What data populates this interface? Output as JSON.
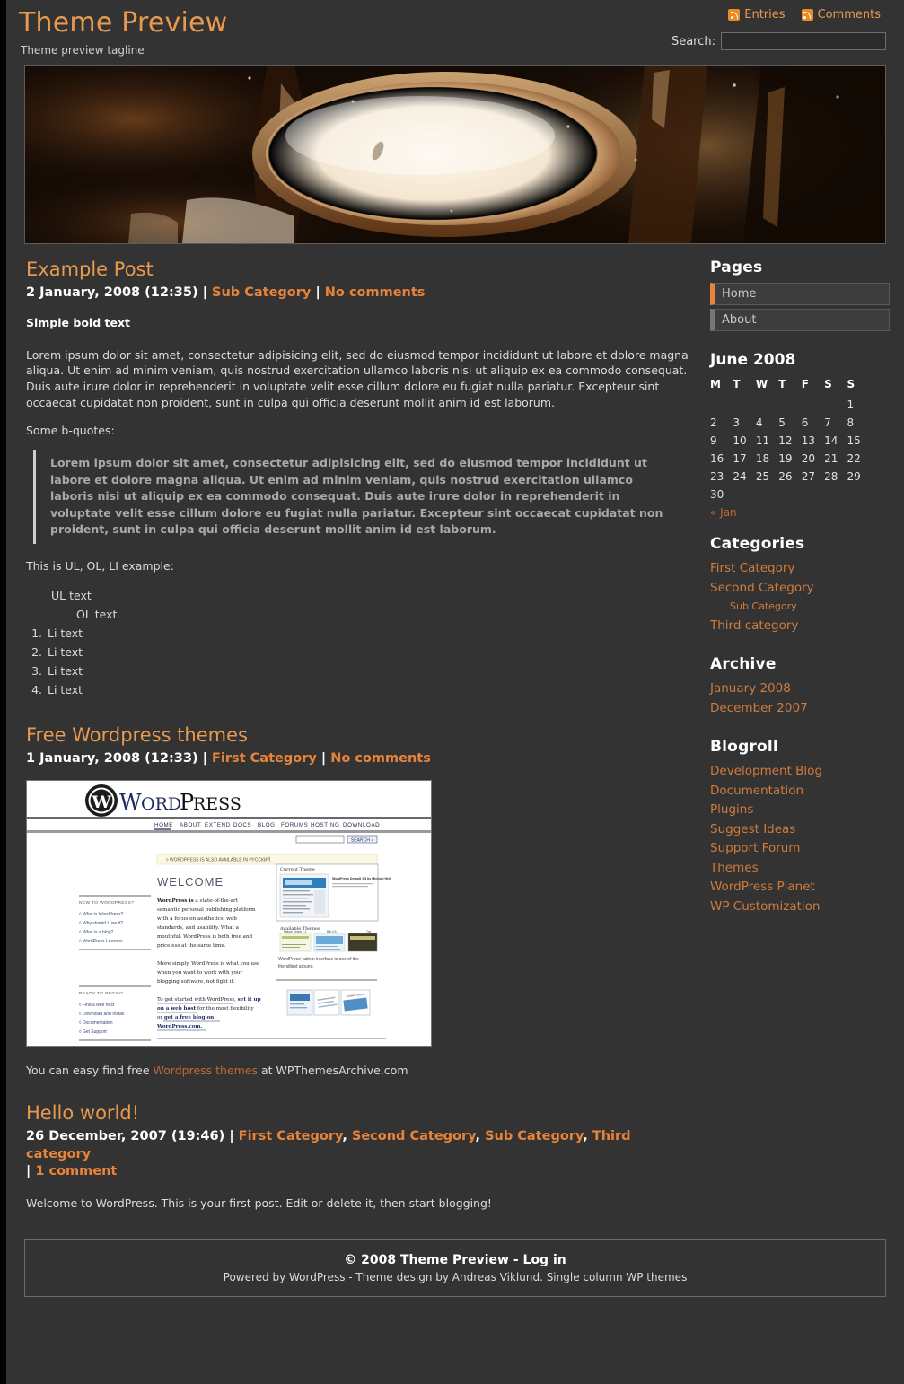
{
  "header": {
    "blog_title": "Theme Preview",
    "tagline": "Theme preview tagline",
    "feed_entries": "Entries",
    "feed_comments": "Comments",
    "search_label": "Search:",
    "search_value": "",
    "search_placeholder": ""
  },
  "colors": {
    "accent": "#e8994f",
    "link": "#cf7b3c",
    "page_bg": "#333333",
    "outer_bg": "#000000",
    "rss_orange": "#e98b28"
  },
  "posts": [
    {
      "title": "Example Post",
      "date": "2 January, 2008 (12:35)",
      "category": "Sub Category",
      "comments": "No comments",
      "bold_line": "Simple bold text",
      "paragraph": "Lorem ipsum dolor sit amet, consectetur adipisicing elit, sed do eiusmod tempor incididunt ut labore et dolore magna aliqua. Ut enim ad minim veniam, quis nostrud exercitation ullamco laboris nisi ut aliquip ex ea commodo consequat. Duis aute irure dolor in reprehenderit in voluptate velit esse cillum dolore eu fugiat nulla pariatur. Excepteur sint occaecat cupidatat non proident, sunt in culpa qui officia deserunt mollit anim id est laborum.",
      "quote_intro": "Some b-quotes:",
      "quote": "Lorem ipsum dolor sit amet, consectetur adipisicing elit, sed do eiusmod tempor incididunt ut labore et dolore magna aliqua. Ut enim ad minim veniam, quis nostrud exercitation ullamco laboris nisi ut aliquip ex ea commodo consequat. Duis aute irure dolor in reprehenderit in voluptate velit esse cillum dolore eu fugiat nulla pariatur. Excepteur sint occaecat cupidatat non proident, sunt in culpa qui officia deserunt mollit anim id est laborum.",
      "list_intro": "This is UL, OL, LI example:",
      "ul_text": "UL text",
      "ol_text": "OL text",
      "li_items": [
        "Li text",
        "Li text",
        "Li text",
        "Li text"
      ]
    },
    {
      "title": "Free Wordpress themes",
      "date": "1 January, 2008 (12:33)",
      "category": "First Category",
      "comments": "No comments",
      "after_image_prefix": "You can easy find free ",
      "after_image_link": "Wordpress themes",
      "after_image_suffix": " at WPThemesArchive.com"
    },
    {
      "title": "Hello world!",
      "date": "26 December, 2007 (19:46)",
      "categories": [
        "First Category",
        "Second Category",
        "Sub Category",
        "Third category"
      ],
      "comments": "1 comment",
      "body": "Welcome to WordPress. This is your first post. Edit or delete it, then start blogging!"
    }
  ],
  "screenshot": {
    "brand": "WORDPRESS",
    "nav": [
      "HOME",
      "ABOUT",
      "EXTEND",
      "DOCS",
      "BLOG",
      "FORUMS",
      "HOSTING",
      "DOWNLOAD"
    ],
    "search_button": "SEARCH »",
    "notice": "◊ WORDPRESS IS ALSO AVAILABLE IN РУССКИЙ.",
    "welcome": "WELCOME",
    "intro_bold": "WordPress is",
    "intro_rest": "a state-of-the-art semantic personal publishing platform with a focus on aesthetics, web standards, and usability. What a mouthful. WordPress is both free and priceless at the same time.",
    "para2": "More simply, WordPress is what you use when you want to work with your blogging software, not fight it.",
    "para3_prefix": "To get started with WordPress, ",
    "para3_link1": "set it up on a web host",
    "para3_mid": " for the most flexibility or ",
    "para3_link2": "get a free blog on WordPress.com",
    "para3_suffix": ".",
    "col_head1": "NEW TO WORDPRESS?",
    "col_links1": [
      "◊ What is WordPress?",
      "◊ Why should I use it?",
      "◊ What is a blog?",
      "◊ WordPress Lessons"
    ],
    "col_head2": "READY TO BEGIN?",
    "col_links2": [
      "◊ Find a web host",
      "◊ Download and Install",
      "◊ Documentation",
      "◊ Get Support"
    ],
    "panel_title": "Current Theme",
    "panel_theme": "WordPress Default 1.5 by Michael Heilemann",
    "panel_sub": "Available Themes",
    "caption": "WordPress' admin interface is one of the friendliest around."
  },
  "sidebar": {
    "pages": {
      "title": "Pages",
      "items": [
        {
          "label": "Home",
          "current": true
        },
        {
          "label": "About",
          "current": false
        }
      ]
    },
    "calendar": {
      "title": "June 2008",
      "weekdays": [
        "M",
        "T",
        "W",
        "T",
        "F",
        "S",
        "S"
      ],
      "weeks": [
        [
          "",
          "",
          "",
          "",
          "",
          "",
          "1"
        ],
        [
          "2",
          "3",
          "4",
          "5",
          "6",
          "7",
          "8"
        ],
        [
          "9",
          "10",
          "11",
          "12",
          "13",
          "14",
          "15"
        ],
        [
          "16",
          "17",
          "18",
          "19",
          "20",
          "21",
          "22"
        ],
        [
          "23",
          "24",
          "25",
          "26",
          "27",
          "28",
          "29"
        ],
        [
          "30",
          "",
          "",
          "",
          "",
          "",
          ""
        ]
      ],
      "prev_link": "« Jan"
    },
    "categories": {
      "title": "Categories",
      "items": [
        {
          "label": "First Category",
          "sub": false
        },
        {
          "label": "Second Category",
          "sub": false
        },
        {
          "label": "Sub Category",
          "sub": true
        },
        {
          "label": "Third category",
          "sub": false
        }
      ]
    },
    "archive": {
      "title": "Archive",
      "items": [
        {
          "label": "January 2008",
          "sub": false
        },
        {
          "label": "December 2007",
          "sub": false
        }
      ]
    },
    "blogroll": {
      "title": "Blogroll",
      "items": [
        {
          "label": "Development Blog",
          "sub": false
        },
        {
          "label": "Documentation",
          "sub": false
        },
        {
          "label": "Plugins",
          "sub": false
        },
        {
          "label": "Suggest Ideas",
          "sub": false
        },
        {
          "label": "Support Forum",
          "sub": false
        },
        {
          "label": "Themes",
          "sub": false
        },
        {
          "label": "WordPress Planet",
          "sub": false
        },
        {
          "label": "WP Customization",
          "sub": false
        }
      ]
    }
  },
  "footer": {
    "line1": "© 2008 Theme Preview - Log in",
    "line2": "Powered by WordPress - Theme design by Andreas Viklund. Single column WP themes"
  }
}
